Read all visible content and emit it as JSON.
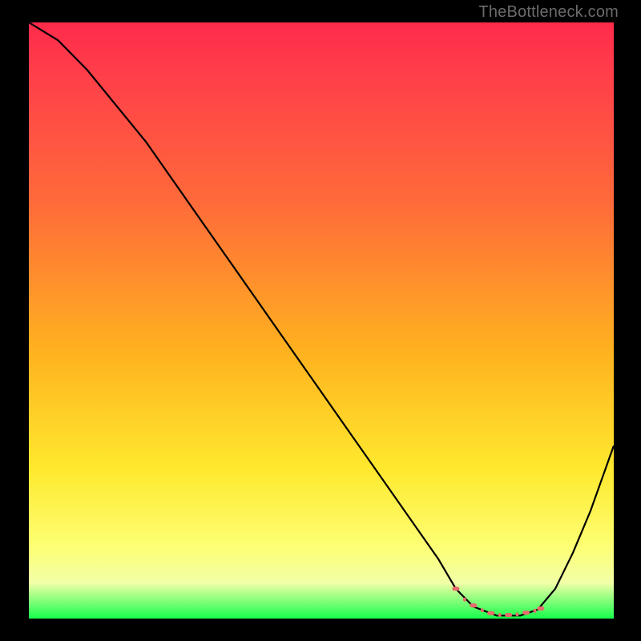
{
  "watermark": "TheBottleneck.com",
  "chart_data": {
    "type": "line",
    "title": "",
    "xlabel": "",
    "ylabel": "",
    "xlim": [
      0,
      100
    ],
    "ylim": [
      0,
      100
    ],
    "series": [
      {
        "name": "curve",
        "color": "#000000",
        "x": [
          0,
          5,
          10,
          15,
          20,
          25,
          30,
          35,
          40,
          45,
          50,
          55,
          60,
          65,
          70,
          73,
          76,
          80,
          84,
          87,
          90,
          93,
          96,
          100
        ],
        "values": [
          100,
          97,
          92,
          86,
          80,
          73,
          66,
          59,
          52,
          45,
          38,
          31,
          24,
          17,
          10,
          5,
          2,
          0.5,
          0.5,
          1.5,
          5,
          11,
          18,
          29
        ]
      },
      {
        "name": "highlight",
        "color": "#e86b6b",
        "x": [
          73,
          74.5,
          76,
          77.5,
          79,
          80.5,
          82,
          83.5,
          85,
          86.5,
          87.5
        ],
        "values": [
          5,
          3.2,
          2.2,
          1.4,
          0.9,
          0.6,
          0.6,
          0.7,
          1.0,
          1.3,
          1.7
        ]
      }
    ]
  }
}
